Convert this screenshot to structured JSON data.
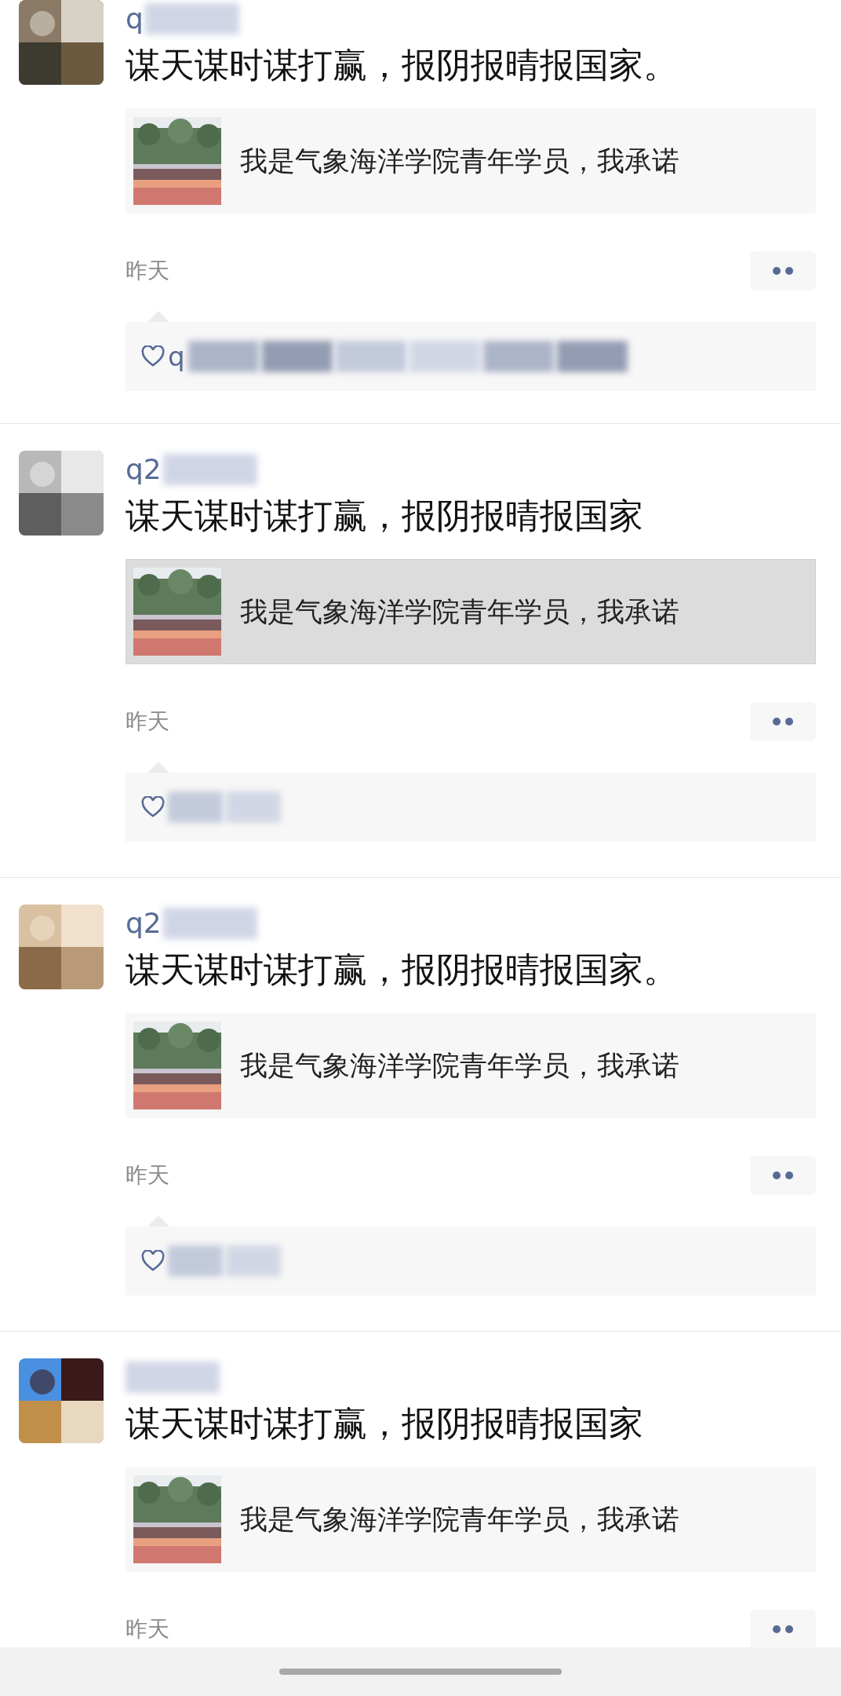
{
  "posts": [
    {
      "name": "q",
      "name_redacted": true,
      "text": "谋天谋时谋打赢，报阴报晴报国家。",
      "link": {
        "title": "我是气象海洋学院青年学员，我承诺",
        "selected": false
      },
      "time": "昨天",
      "likes": {
        "visible": "q",
        "redacted": true
      }
    },
    {
      "name": "q2",
      "name_redacted": true,
      "text": "谋天谋时谋打赢，报阴报晴报国家",
      "link": {
        "title": "我是气象海洋学院青年学员，我承诺",
        "selected": true
      },
      "time": "昨天",
      "likes": {
        "redacted": true
      }
    },
    {
      "name": "q2",
      "name_redacted": true,
      "text": "谋天谋时谋打赢，报阴报晴报国家。",
      "link": {
        "title": "我是气象海洋学院青年学员，我承诺",
        "selected": false
      },
      "time": "昨天",
      "likes": {
        "redacted": true
      }
    },
    {
      "name_redacted": true,
      "text": "谋天谋时谋打赢，报阴报晴报国家",
      "link": {
        "title": "我是气象海洋学院青年学员，我承诺",
        "selected": false
      },
      "time": "昨天"
    }
  ]
}
